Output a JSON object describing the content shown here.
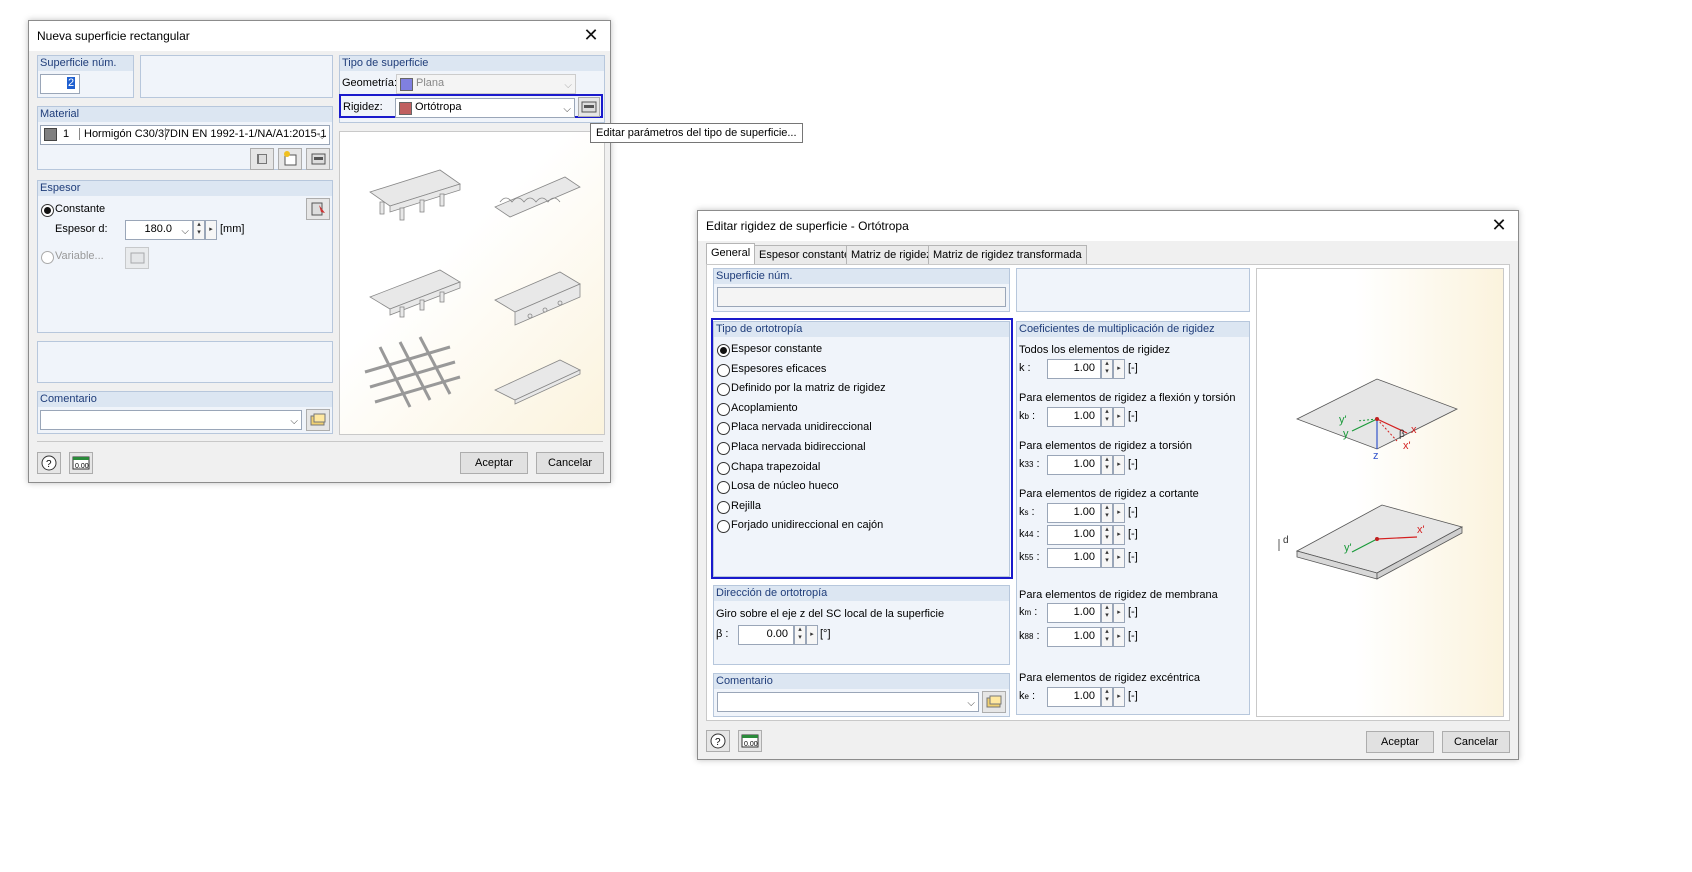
{
  "dialog1": {
    "title": "Nueva superficie rectangular",
    "surface_no_label": "Superficie núm.",
    "surface_no_value": "2",
    "material_label": "Material",
    "material_index": "1",
    "material_name": "Hormigón C30/37",
    "material_norm": "DIN EN 1992-1-1/NA/A1:2015-1",
    "thickness_label": "Espesor",
    "constant_label": "Constante",
    "thickness_d_label": "Espesor d:",
    "thickness_d_value": "180.0",
    "thickness_unit": "[mm]",
    "variable_label": "Variable...",
    "comment_label": "Comentario",
    "surface_type_label": "Tipo de superficie",
    "geometry_label": "Geometría:",
    "geometry_value": "Plana",
    "geometry_color": "#8080e0",
    "stiffness_label": "Rigidez:",
    "stiffness_value": "Ortótropa",
    "stiffness_color": "#c06060",
    "tooltip": "Editar parámetros del tipo de superficie...",
    "ok_label": "Aceptar",
    "cancel_label": "Cancelar"
  },
  "dialog2": {
    "title": "Editar rigidez de superficie - Ortótropa",
    "tabs": [
      "General",
      "Espesor constante",
      "Matriz de rigidez",
      "Matriz de rigidez transformada"
    ],
    "surface_no_label": "Superficie núm.",
    "orthotropy_type_label": "Tipo de ortotropía",
    "orthotropy_options": [
      "Espesor constante",
      "Espesores eficaces",
      "Definido por la matriz de rigidez",
      "Acoplamiento",
      "Placa nervada unidireccional",
      "Placa nervada bidireccional",
      "Chapa trapezoidal",
      "Losa de núcleo hueco",
      "Rejilla",
      "Forjado unidireccional en cajón"
    ],
    "selected_option_index": 0,
    "direction_label": "Dirección de ortotropía",
    "rotation_label": "Giro sobre el eje z del SC local de la superficie",
    "beta_label": "β :",
    "beta_value": "0.00",
    "beta_unit": "[°]",
    "comment_label": "Comentario",
    "coef_label": "Coeficientes de multiplicación de rigidez",
    "coef_groups": {
      "all": "Todos los elementos de rigidez",
      "bending": "Para elementos de rigidez a flexión y torsión",
      "torsion": "Para elementos de rigidez a torsión",
      "shear": "Para elementos de rigidez a cortante",
      "membrane": "Para elementos de rigidez de membrana",
      "eccentric": "Para elementos de rigidez excéntrica"
    },
    "coefs": {
      "k": {
        "sym": "k",
        "sub": "",
        "value": "1.00"
      },
      "kb": {
        "sym": "k",
        "sub": "b",
        "value": "1.00"
      },
      "k33": {
        "sym": "k",
        "sub": "33",
        "value": "1.00"
      },
      "ks": {
        "sym": "k",
        "sub": "s",
        "value": "1.00"
      },
      "k44": {
        "sym": "k",
        "sub": "44",
        "value": "1.00"
      },
      "k55": {
        "sym": "k",
        "sub": "55",
        "value": "1.00"
      },
      "km": {
        "sym": "k",
        "sub": "m",
        "value": "1.00"
      },
      "k88": {
        "sym": "k",
        "sub": "88",
        "value": "1.00"
      },
      "ke": {
        "sym": "k",
        "sub": "e",
        "value": "1.00"
      }
    },
    "unit": "[-]",
    "diagram_labels": {
      "y_prime": "y'",
      "y": "y",
      "x": "x",
      "x_prime": "x'",
      "z": "z",
      "beta": "β",
      "d": "d"
    },
    "ok_label": "Aceptar",
    "cancel_label": "Cancelar"
  },
  "colors": {
    "highlight": "#1a1acc",
    "group_header": "#dce6f2",
    "accent_red": "#d42020",
    "accent_green": "#1a9a3a"
  }
}
